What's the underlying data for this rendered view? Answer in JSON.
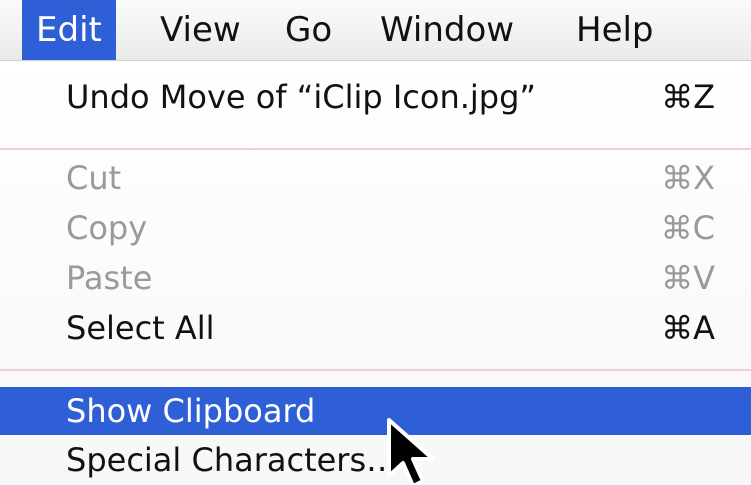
{
  "menubar": {
    "items": [
      {
        "label": "Edit"
      },
      {
        "label": "View"
      },
      {
        "label": "Go"
      },
      {
        "label": "Window"
      },
      {
        "label": "Help"
      }
    ],
    "active_index": 0,
    "highlight_color": "#2f5fd6"
  },
  "edit_menu": {
    "items": [
      {
        "label": "Undo Move of “iClip Icon.jpg”",
        "shortcut": "⌘Z",
        "enabled": true
      },
      {
        "label": "Cut",
        "shortcut": "⌘X",
        "enabled": false
      },
      {
        "label": "Copy",
        "shortcut": "⌘C",
        "enabled": false
      },
      {
        "label": "Paste",
        "shortcut": "⌘V",
        "enabled": false
      },
      {
        "label": "Select All",
        "shortcut": "⌘A",
        "enabled": true
      },
      {
        "label": "Show Clipboard",
        "shortcut": "",
        "enabled": true,
        "highlighted": true
      },
      {
        "label": "Special Characters…",
        "shortcut": "",
        "enabled": true
      }
    ]
  },
  "cursor": {
    "icon": "arrow-pointer-icon"
  }
}
